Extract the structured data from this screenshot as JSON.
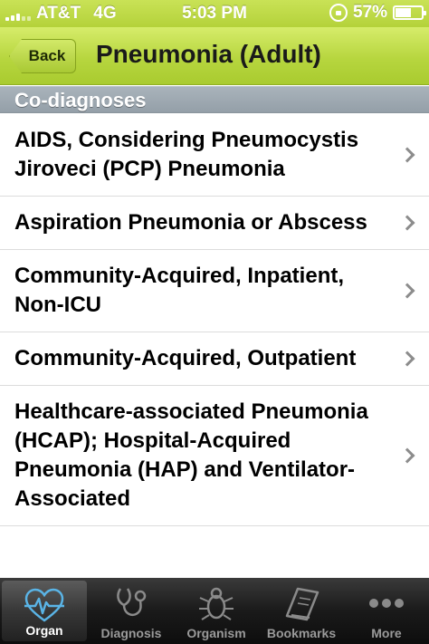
{
  "status_bar": {
    "carrier": "AT&T",
    "network": "4G",
    "time": "5:03 PM",
    "battery_percent": "57%",
    "battery_level": 0.57
  },
  "nav": {
    "back_label": "Back",
    "title": "Pneumonia (Adult)"
  },
  "section": {
    "header": "Co-diagnoses"
  },
  "list": {
    "items": [
      {
        "label": "AIDS, Considering Pneumocystis Jiroveci (PCP) Pneumonia"
      },
      {
        "label": "Aspiration Pneumonia or Abscess"
      },
      {
        "label": "Community-Acquired, Inpatient, Non-ICU"
      },
      {
        "label": "Community-Acquired, Outpatient"
      },
      {
        "label": "Healthcare-associated Pneumonia (HCAP); Hospital-Acquired Pneumonia (HAP) and Ventilator-Associated"
      }
    ]
  },
  "tabs": [
    {
      "label": "Organ",
      "icon": "heart-ecg-icon",
      "active": true
    },
    {
      "label": "Diagnosis",
      "icon": "stethoscope-icon",
      "active": false
    },
    {
      "label": "Organism",
      "icon": "bug-icon",
      "active": false
    },
    {
      "label": "Bookmarks",
      "icon": "book-icon",
      "active": false
    },
    {
      "label": "More",
      "icon": "more-dots-icon",
      "active": false
    }
  ],
  "colors": {
    "nav_green": "#b7d63f",
    "section_gray": "#a0aab2",
    "tab_bar": "#1a1a1a",
    "active_icon": "#5ab4e6"
  }
}
